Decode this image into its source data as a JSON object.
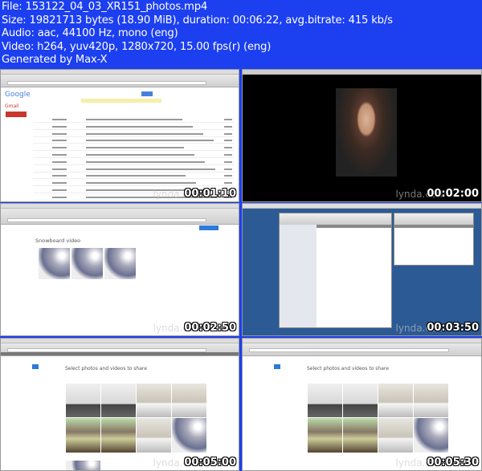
{
  "header": {
    "file": "File: 153122_04_03_XR151_photos.mp4",
    "size": "Size: 19821713 bytes (18.90 MiB), duration: 00:06:22, avg.bitrate: 415 kb/s",
    "audio": "Audio: aac, 44100 Hz, mono (eng)",
    "video": "Video: h264, yuv420p, 1280x720, 15.00 fps(r) (eng)",
    "generator": "Generated by Max-X"
  },
  "watermark": "lynda.com",
  "thumbnails": [
    {
      "timestamp": "00:01:10",
      "app_logo": "Google",
      "label": "Gmail"
    },
    {
      "timestamp": "00:02:00"
    },
    {
      "timestamp": "00:02:50",
      "label": "Snowboard video"
    },
    {
      "timestamp": "00:03:50"
    },
    {
      "timestamp": "00:05:00",
      "label": "Select photos and videos to share"
    },
    {
      "timestamp": "00:05:30",
      "label": "Select photos and videos to share"
    }
  ],
  "colors": {
    "header_bg": "#1c3ff0",
    "desktop_blue": "#2c5a94"
  }
}
